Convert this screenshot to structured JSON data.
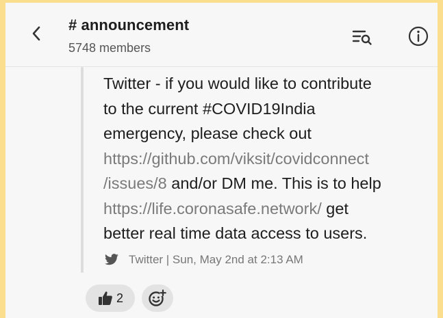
{
  "header": {
    "channel_name": "# announcement",
    "member_count": "5748 members"
  },
  "message": {
    "lines": [
      {
        "parts": [
          {
            "text": " Twitter - if you would like to contribute",
            "link": false
          }
        ]
      },
      {
        "parts": [
          {
            "text": "to the current #COVID19India",
            "link": false
          }
        ]
      },
      {
        "parts": [
          {
            "text": "emergency, please check out",
            "link": false
          }
        ]
      },
      {
        "parts": [
          {
            "text": "https://github.com/viksit/covidconnect",
            "link": true
          }
        ]
      },
      {
        "parts": [
          {
            "text": "/issues/8",
            "link": true
          },
          {
            "text": " and/or DM me. This is to help",
            "link": false
          }
        ]
      },
      {
        "parts": [
          {
            "text": "https://life.coronasafe.network/",
            "link": true
          },
          {
            "text": " get",
            "link": false
          }
        ]
      },
      {
        "parts": [
          {
            "text": "better real time data access to users.",
            "link": false
          }
        ]
      }
    ],
    "meta": "Twitter | Sun, May 2nd at 2:13 AM"
  },
  "reactions": {
    "thumbs_up_count": "2"
  },
  "icons": {
    "back": "chevron-left-icon",
    "search_list": "search-list-icon",
    "info": "info-icon",
    "twitter": "twitter-bird-icon",
    "thumbs_up": "thumbs-up-icon",
    "add_reaction": "add-reaction-icon"
  },
  "colors": {
    "frame_border": "#fbdf8e",
    "link": "#7a7a7a",
    "reaction_bg": "#e3e3e3"
  }
}
